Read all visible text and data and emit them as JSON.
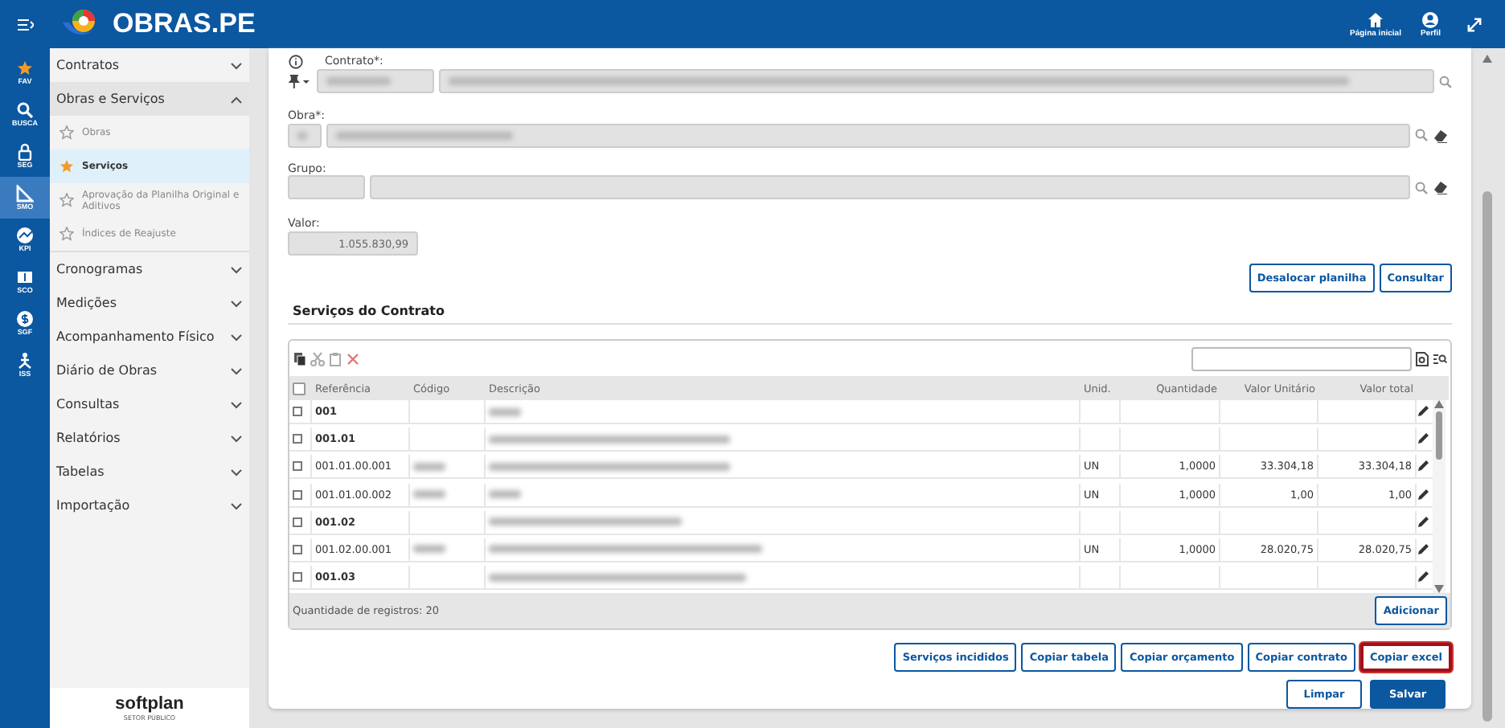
{
  "header": {
    "app_title": "OBRAS.PE",
    "actions": [
      {
        "kind": "home",
        "label": "Página inicial"
      },
      {
        "kind": "profile",
        "label": "Perfil"
      }
    ]
  },
  "rail": [
    {
      "kind": "star",
      "label": "FAV",
      "selected": false
    },
    {
      "kind": "search",
      "label": "BUSCA",
      "selected": false
    },
    {
      "kind": "lock",
      "label": "SEG",
      "selected": false
    },
    {
      "kind": "ruler",
      "label": "SMO",
      "selected": true
    },
    {
      "kind": "gauge",
      "label": "KPI",
      "selected": false
    },
    {
      "kind": "money",
      "label": "SCO",
      "selected": false
    },
    {
      "kind": "coin",
      "label": "SGF",
      "selected": false
    },
    {
      "kind": "person",
      "label": "ISS",
      "selected": false
    }
  ],
  "sidebar": {
    "items": [
      {
        "label": "Contratos",
        "expanded": false
      },
      {
        "label": "Obras e Serviços",
        "expanded": true,
        "children": [
          {
            "label": "Obras",
            "selected": false,
            "favorite": false
          },
          {
            "label": "Serviços",
            "selected": true,
            "favorite": true
          },
          {
            "label": "Aprovação da Planilha Original e Aditivos",
            "selected": false,
            "favorite": false
          },
          {
            "label": "Índices de Reajuste",
            "selected": false,
            "favorite": false
          }
        ]
      },
      {
        "label": "Cronogramas",
        "expanded": false
      },
      {
        "label": "Medições",
        "expanded": false
      },
      {
        "label": "Acompanhamento Físico",
        "expanded": false
      },
      {
        "label": "Diário de Obras",
        "expanded": false
      },
      {
        "label": "Consultas",
        "expanded": false
      },
      {
        "label": "Relatórios",
        "expanded": false
      },
      {
        "label": "Tabelas",
        "expanded": false
      },
      {
        "label": "Importação",
        "expanded": false
      }
    ],
    "footer": {
      "brand": "softplan",
      "subtitle": "SETOR PÚBLICO"
    }
  },
  "form": {
    "contrato": {
      "label": "Contrato*:"
    },
    "obra": {
      "label": "Obra*:"
    },
    "grupo": {
      "label": "Grupo:"
    },
    "valor": {
      "label": "Valor:",
      "value": "1.055.830,99"
    },
    "buttons": [
      "Desalocar planilha",
      "Consultar"
    ]
  },
  "services": {
    "title": "Serviços do Contrato",
    "columns": [
      "Referência",
      "Código",
      "Descrição",
      "Unid.",
      "Quantidade",
      "Valor Unitário",
      "Valor total"
    ],
    "rows": [
      {
        "kind": "group",
        "reference": "001",
        "checked": false
      },
      {
        "kind": "group",
        "reference": "001.01",
        "checked": false
      },
      {
        "kind": "item",
        "reference": "001.01.00.001",
        "checked": false,
        "unit": "UN",
        "quantity": "1,0000",
        "unit_value": "33.304,18",
        "total": "33.304,18"
      },
      {
        "kind": "item",
        "reference": "001.01.00.002",
        "checked": false,
        "unit": "UN",
        "quantity": "1,0000",
        "unit_value": "1,00",
        "total": "1,00"
      },
      {
        "kind": "group",
        "reference": "001.02",
        "checked": false
      },
      {
        "kind": "item",
        "reference": "001.02.00.001",
        "checked": false,
        "unit": "UN",
        "quantity": "1,0000",
        "unit_value": "28.020,75",
        "total": "28.020,75"
      },
      {
        "kind": "group",
        "reference": "001.03",
        "checked": false
      }
    ],
    "all_checked": false,
    "record_count": "Quantidade de registros: 20",
    "add_button": "Adicionar"
  },
  "actions": [
    {
      "label": "Serviços incididos",
      "highlighted": false
    },
    {
      "label": "Copiar tabela",
      "highlighted": false
    },
    {
      "label": "Copiar orçamento",
      "highlighted": false
    },
    {
      "label": "Copiar contrato",
      "highlighted": false
    },
    {
      "label": "Copiar excel",
      "highlighted": true
    }
  ],
  "footer_buttons": [
    {
      "kind": "secondary",
      "label": "Limpar"
    },
    {
      "kind": "primary",
      "label": "Salvar"
    }
  ]
}
